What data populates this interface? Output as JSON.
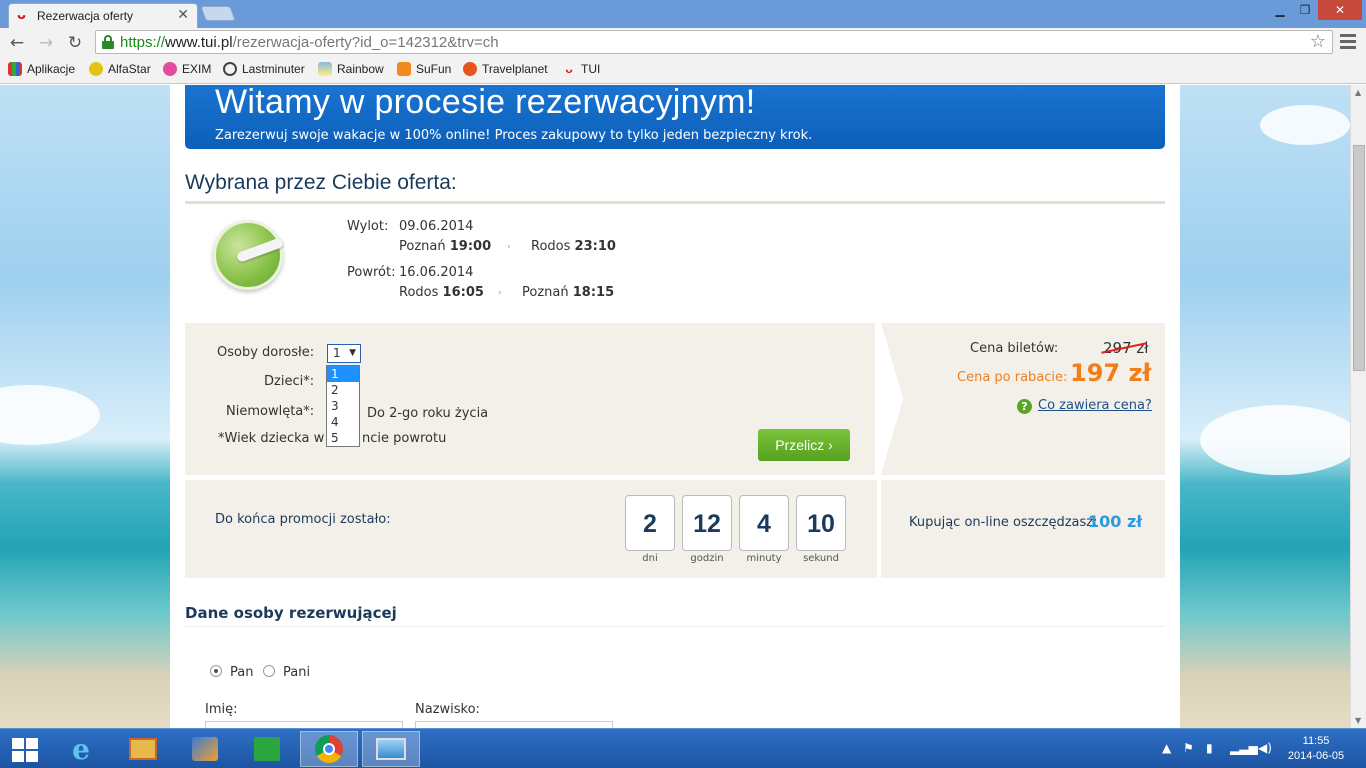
{
  "browser": {
    "tab_title": "Rezerwacja oferty",
    "tab_close": "✕",
    "url_protocol": "https://",
    "url_host": "www.tui.pl",
    "url_rest": "/rezerwacja-oferty?id_o=142312&trv=ch",
    "bookmarks": [
      "Aplikacje",
      "AlfaStar",
      "EXIM",
      "Lastminuter",
      "Rainbow",
      "SuFun",
      "Travelplanet",
      "TUI"
    ]
  },
  "banner": {
    "title": "Witamy w procesie rezerwacyjnym!",
    "subtitle": "Zarezerwuj swoje wakacje w 100% online! Proces zakupowy to tylko jeden bezpieczny krok."
  },
  "offer": {
    "title": "Wybrana przez Ciebie oferta:",
    "departure_label": "Wylot:",
    "departure_date": "09.06.2014",
    "departure_from_city": "Poznań",
    "departure_from_time": "19:00",
    "departure_to_city": "Rodos",
    "departure_to_time": "23:10",
    "return_label": "Powrót:",
    "return_date": "16.06.2014",
    "return_from_city": "Rodos",
    "return_from_time": "16:05",
    "return_to_city": "Poznań",
    "return_to_time": "18:15"
  },
  "passengers": {
    "adults_label": "Osoby dorosłe:",
    "adults_value": "1",
    "adults_options": [
      "1",
      "2",
      "3",
      "4",
      "5"
    ],
    "children_label": "Dzieci*:",
    "infants_label": "Niemowlęta*:",
    "infants_note": "Do 2-go roku życia",
    "age_note_start": "*Wiek dziecka w",
    "age_note_end": "ncie powrotu",
    "recalc_button": "Przelicz"
  },
  "price": {
    "tickets_label": "Cena biletów:",
    "old_price": "297 zł",
    "discount_label": "Cena po rabacie:",
    "new_price": "197 zł",
    "help_link": "Co zawiera cena?"
  },
  "promo": {
    "label": "Do końca promocji zostało:",
    "days": "2",
    "days_label": "dni",
    "hours": "12",
    "hours_label": "godzin",
    "minutes": "4",
    "minutes_label": "minuty",
    "seconds": "10",
    "seconds_label": "sekund",
    "save_text": "Kupując on-line oszczędzasz:",
    "save_amount": "100 zł"
  },
  "booker": {
    "title": "Dane osoby rezerwującej",
    "mr": "Pan",
    "mrs": "Pani",
    "first_name_label": "Imię:",
    "last_name_label": "Nazwisko:"
  },
  "taskbar": {
    "time": "11:55",
    "date": "2014-06-05"
  },
  "colors": {
    "accent_blue": "#0b5fba",
    "price_orange": "#f07f1a",
    "button_green": "#55a020"
  }
}
